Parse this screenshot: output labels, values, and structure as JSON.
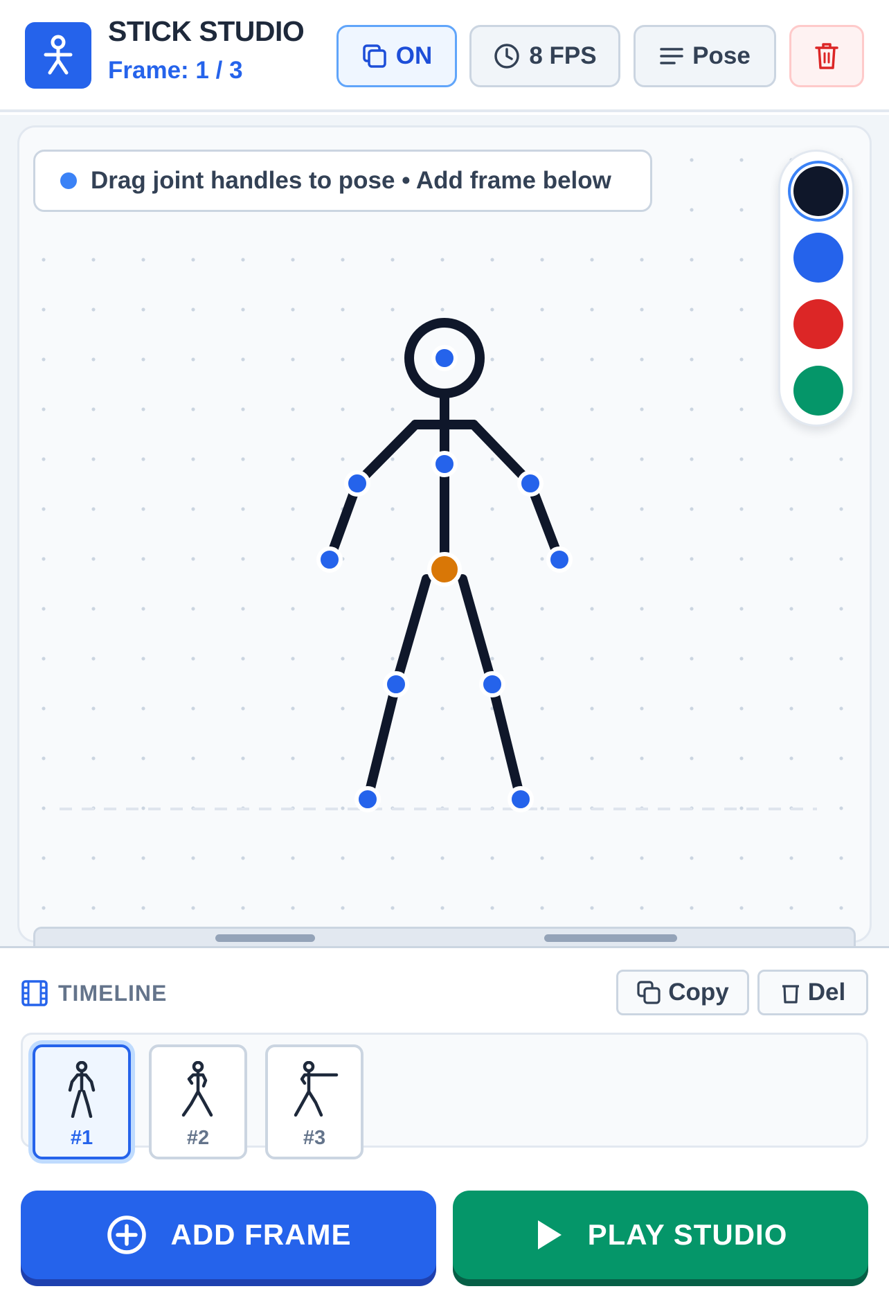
{
  "header": {
    "app_title": "STICK STUDIO",
    "frame_label": "Frame: 1 / 3",
    "onion_label": "ON",
    "fps_label": "8 FPS",
    "mode_label": "Pose",
    "icons": {
      "logo": "stick-figure-icon",
      "onion": "layers-icon",
      "fps": "clock-icon",
      "mode": "lines-icon",
      "trash": "trash-icon"
    }
  },
  "canvas": {
    "hint": "Drag joint handles to pose • Add frame below",
    "palette": [
      {
        "name": "black",
        "color": "#0f172a",
        "selected": true
      },
      {
        "name": "blue",
        "color": "#2563eb",
        "selected": false
      },
      {
        "name": "red",
        "color": "#dc2626",
        "selected": false
      },
      {
        "name": "green",
        "color": "#059669",
        "selected": false
      }
    ],
    "joints": [
      "head",
      "neck",
      "left-elbow",
      "right-elbow",
      "left-hand",
      "right-hand",
      "hip",
      "left-knee",
      "right-knee",
      "left-foot",
      "right-foot"
    ],
    "active_joint": "hip",
    "joint_color": "#2563eb",
    "active_joint_color": "#d97706"
  },
  "timeline": {
    "title": "TIMELINE",
    "copy_label": "Copy",
    "delete_label": "Del",
    "frames": [
      {
        "label": "#1",
        "active": true
      },
      {
        "label": "#2",
        "active": false
      },
      {
        "label": "#3",
        "active": false
      }
    ]
  },
  "actions": {
    "add_frame": "ADD FRAME",
    "play": "PLAY STUDIO"
  }
}
